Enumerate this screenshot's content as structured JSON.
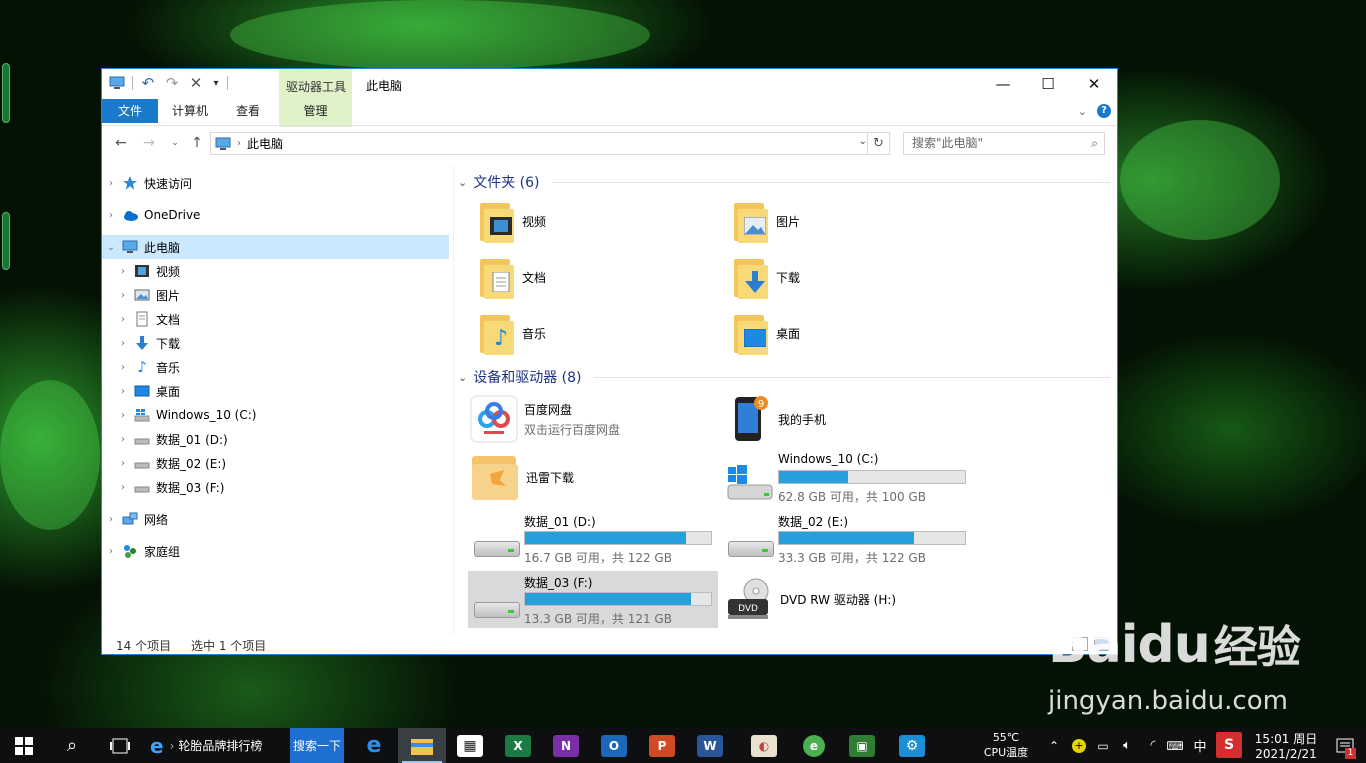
{
  "window": {
    "context_group": "驱动器工具",
    "title": "此电脑",
    "tabs": [
      "文件",
      "计算机",
      "查看",
      "管理"
    ]
  },
  "address": {
    "path": "此电脑",
    "search_placeholder": "搜索\"此电脑\""
  },
  "nav": {
    "quick_access": "快速访问",
    "onedrive": "OneDrive",
    "this_pc": "此电脑",
    "children": [
      "视频",
      "图片",
      "文档",
      "下载",
      "音乐",
      "桌面",
      "Windows_10 (C:)",
      "数据_01 (D:)",
      "数据_02 (E:)",
      "数据_03 (F:)"
    ],
    "network": "网络",
    "homegroup": "家庭组"
  },
  "folders": {
    "header": "文件夹 (6)",
    "items": [
      "视频",
      "图片",
      "文档",
      "下载",
      "音乐",
      "桌面"
    ]
  },
  "devices": {
    "header": "设备和驱动器 (8)",
    "baidu": {
      "name": "百度网盘",
      "sub": "双击运行百度网盘"
    },
    "phone": {
      "name": "我的手机",
      "badge": "9"
    },
    "xunlei": {
      "name": "迅雷下载"
    },
    "drives": [
      {
        "name": "Windows_10 (C:)",
        "free": "62.8 GB 可用，共 100 GB",
        "used": 0.372
      },
      {
        "name": "数据_01 (D:)",
        "free": "16.7 GB 可用，共 122 GB",
        "used": 0.863
      },
      {
        "name": "数据_02 (E:)",
        "free": "33.3 GB 可用，共 122 GB",
        "used": 0.727
      },
      {
        "name": "数据_03 (F:)",
        "free": "13.3 GB 可用，共 121 GB",
        "used": 0.89
      }
    ],
    "dvd": {
      "name": "DVD RW 驱动器 (H:)",
      "label": "DVD"
    }
  },
  "status": {
    "count": "14 个项目",
    "selected": "选中 1 个项目"
  },
  "taskbar": {
    "ie_title": "轮胎品牌排行榜",
    "search_btn": "搜索一下",
    "temp": "55℃",
    "temp_label": "CPU温度",
    "ime": "中",
    "time": "15:01 周日",
    "date": "2021/2/21",
    "notif_count": "1"
  },
  "watermark": {
    "brand": "Baidu",
    "cn": "经验",
    "url": "jingyan.baidu.com"
  }
}
